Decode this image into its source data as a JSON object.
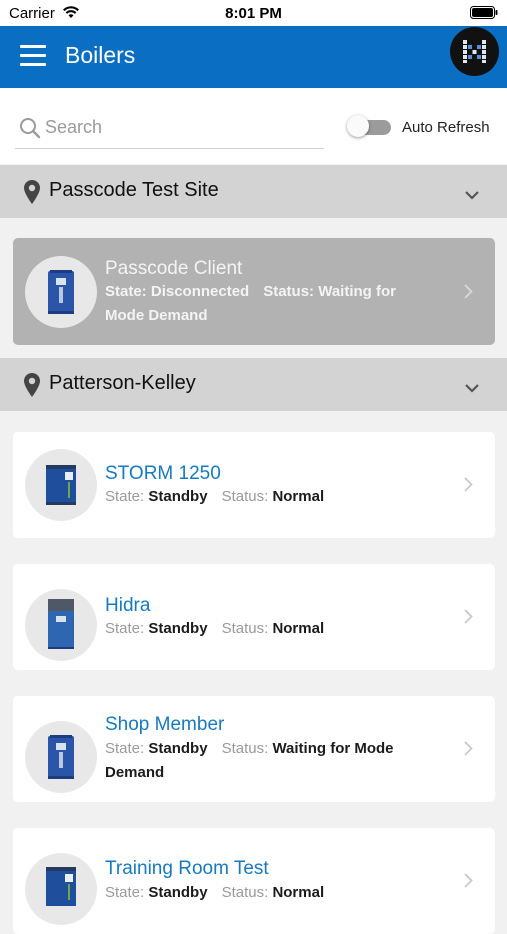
{
  "status_bar": {
    "carrier": "Carrier",
    "time": "8:01 PM"
  },
  "header": {
    "title": "Boilers"
  },
  "search": {
    "placeholder": "Search"
  },
  "auto_refresh": {
    "label": "Auto Refresh",
    "enabled": false
  },
  "sites": [
    {
      "name": "Passcode Test Site",
      "boilers": [
        {
          "name": "Passcode Client",
          "state_label": "State:",
          "state": "Disconnected",
          "status_label": "Status:",
          "status": "Waiting for Mode Demand",
          "connected": false
        }
      ]
    },
    {
      "name": "Patterson-Kelley",
      "boilers": [
        {
          "name": "STORM 1250",
          "state_label": "State:",
          "state": "Standby",
          "status_label": "Status:",
          "status": "Normal",
          "connected": true
        },
        {
          "name": "Hidra",
          "state_label": "State:",
          "state": "Standby",
          "status_label": "Status:",
          "status": "Normal",
          "connected": true
        },
        {
          "name": "Shop Member",
          "state_label": "State:",
          "state": "Standby",
          "status_label": "Status:",
          "status": "Waiting for Mode Demand",
          "connected": true
        },
        {
          "name": "Training Room Test",
          "state_label": "State:",
          "state": "Standby",
          "status_label": "Status:",
          "status": "Normal",
          "connected": true
        }
      ]
    }
  ],
  "colors": {
    "app_bar": "#0a6fc2",
    "link": "#1879bf",
    "site_header": "#d3d3d3",
    "disconnected_card": "#b2b2b2"
  },
  "icons": [
    "wifi-icon",
    "battery-icon",
    "menu-icon",
    "logo-icon",
    "search-icon",
    "map-pin-icon",
    "chevron-down-icon",
    "chevron-right-icon",
    "boiler-icon"
  ]
}
